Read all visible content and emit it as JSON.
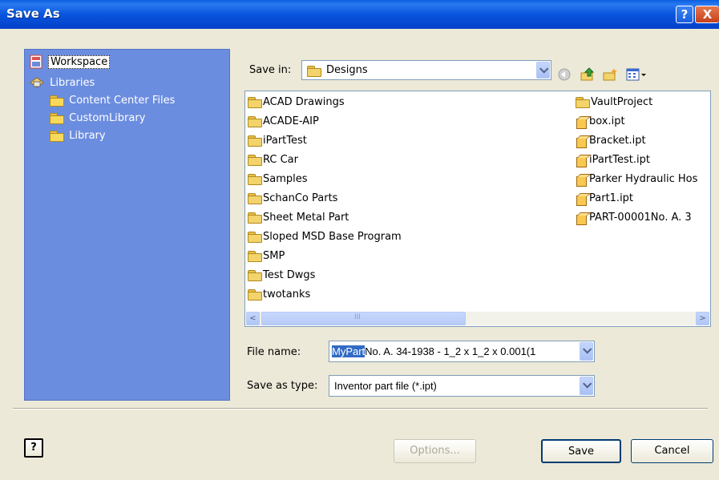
{
  "window": {
    "title": "Save As"
  },
  "titlebar": {
    "help_glyph": "?",
    "close_glyph": "X"
  },
  "places": [
    {
      "label": "Workspace",
      "icon": "workspace-icon",
      "selected": true
    },
    {
      "label": "Libraries",
      "icon": "libraries-icon"
    },
    {
      "label": "Content Center Files",
      "icon": "folder-icon"
    },
    {
      "label": "CustomLibrary",
      "icon": "folder-icon"
    },
    {
      "label": "Library",
      "icon": "folder-icon"
    }
  ],
  "save_in": {
    "label": "Save in:",
    "value": "Designs"
  },
  "files_left": [
    {
      "name": "ACAD Drawings",
      "type": "folder"
    },
    {
      "name": "ACADE-AIP",
      "type": "folder"
    },
    {
      "name": "iPartTest",
      "type": "folder"
    },
    {
      "name": "RC Car",
      "type": "folder"
    },
    {
      "name": "Samples",
      "type": "folder"
    },
    {
      "name": "SchanCo Parts",
      "type": "folder"
    },
    {
      "name": "Sheet Metal Part",
      "type": "folder"
    },
    {
      "name": "Sloped MSD Base Program",
      "type": "folder"
    },
    {
      "name": "SMP",
      "type": "folder"
    },
    {
      "name": "Test Dwgs",
      "type": "folder"
    },
    {
      "name": "twotanks",
      "type": "folder"
    }
  ],
  "files_right": [
    {
      "name": "VaultProject",
      "type": "folder"
    },
    {
      "name": "box.ipt",
      "type": "part"
    },
    {
      "name": "Bracket.ipt",
      "type": "part"
    },
    {
      "name": "iPartTest.ipt",
      "type": "part"
    },
    {
      "name": "Parker Hydraulic Hos",
      "type": "part"
    },
    {
      "name": "Part1.ipt",
      "type": "part"
    },
    {
      "name": "PART-00001No. A. 3",
      "type": "part"
    }
  ],
  "file_name": {
    "label": "File name:",
    "selected": "MyPart",
    "rest": "No. A. 34-1938 - 1_2 x 1_2 x 0.001(1"
  },
  "save_type": {
    "label": "Save as type:",
    "value": "Inventor part file (*.ipt)"
  },
  "buttons": {
    "options": "Options...",
    "save": "Save",
    "cancel": "Cancel",
    "help": "?"
  },
  "scroll": {
    "left": "<",
    "right": ">",
    "grip": "III"
  }
}
